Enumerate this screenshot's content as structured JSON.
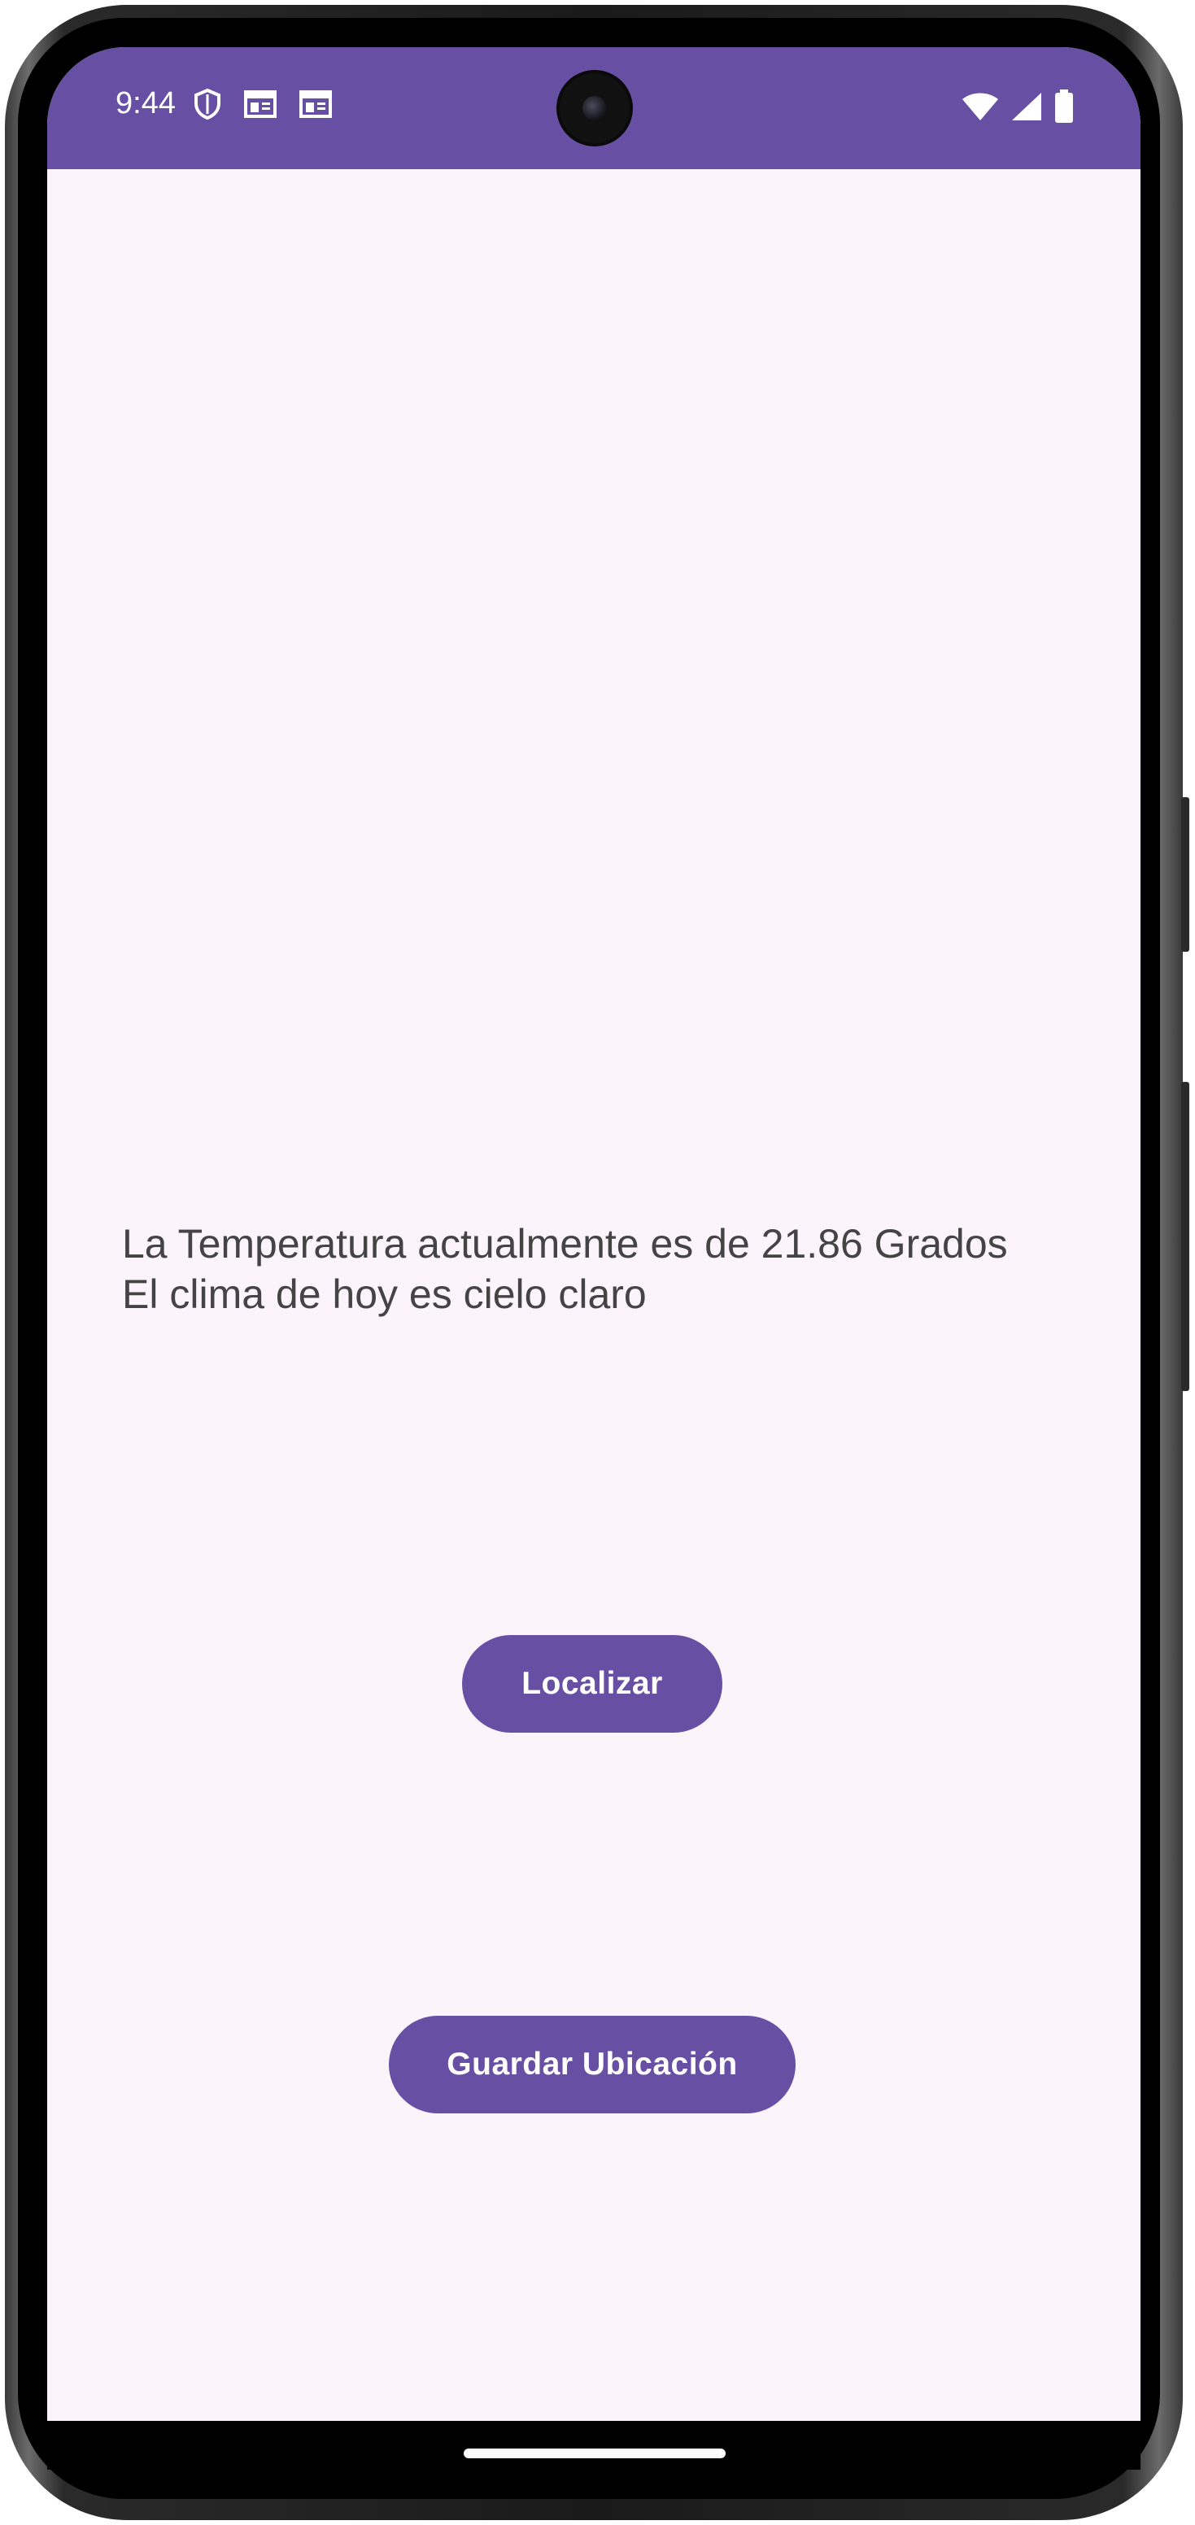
{
  "status_bar": {
    "time": "9:44",
    "left_icons": [
      "shield-icon",
      "calendar-icon",
      "calendar-icon"
    ],
    "right_icons": [
      "wifi-icon",
      "cell-signal-icon",
      "battery-icon"
    ],
    "color": "#6750a4"
  },
  "main": {
    "weather_line_1": "La Temperatura actualmente es de 21.86 Grados",
    "weather_line_2": "El clima de hoy es cielo claro",
    "localizar_label": "Localizar",
    "guardar_label": "Guardar Ubicación"
  },
  "theme": {
    "primary": "#6750a4",
    "background": "#fcf4fb",
    "text": "#444444"
  }
}
